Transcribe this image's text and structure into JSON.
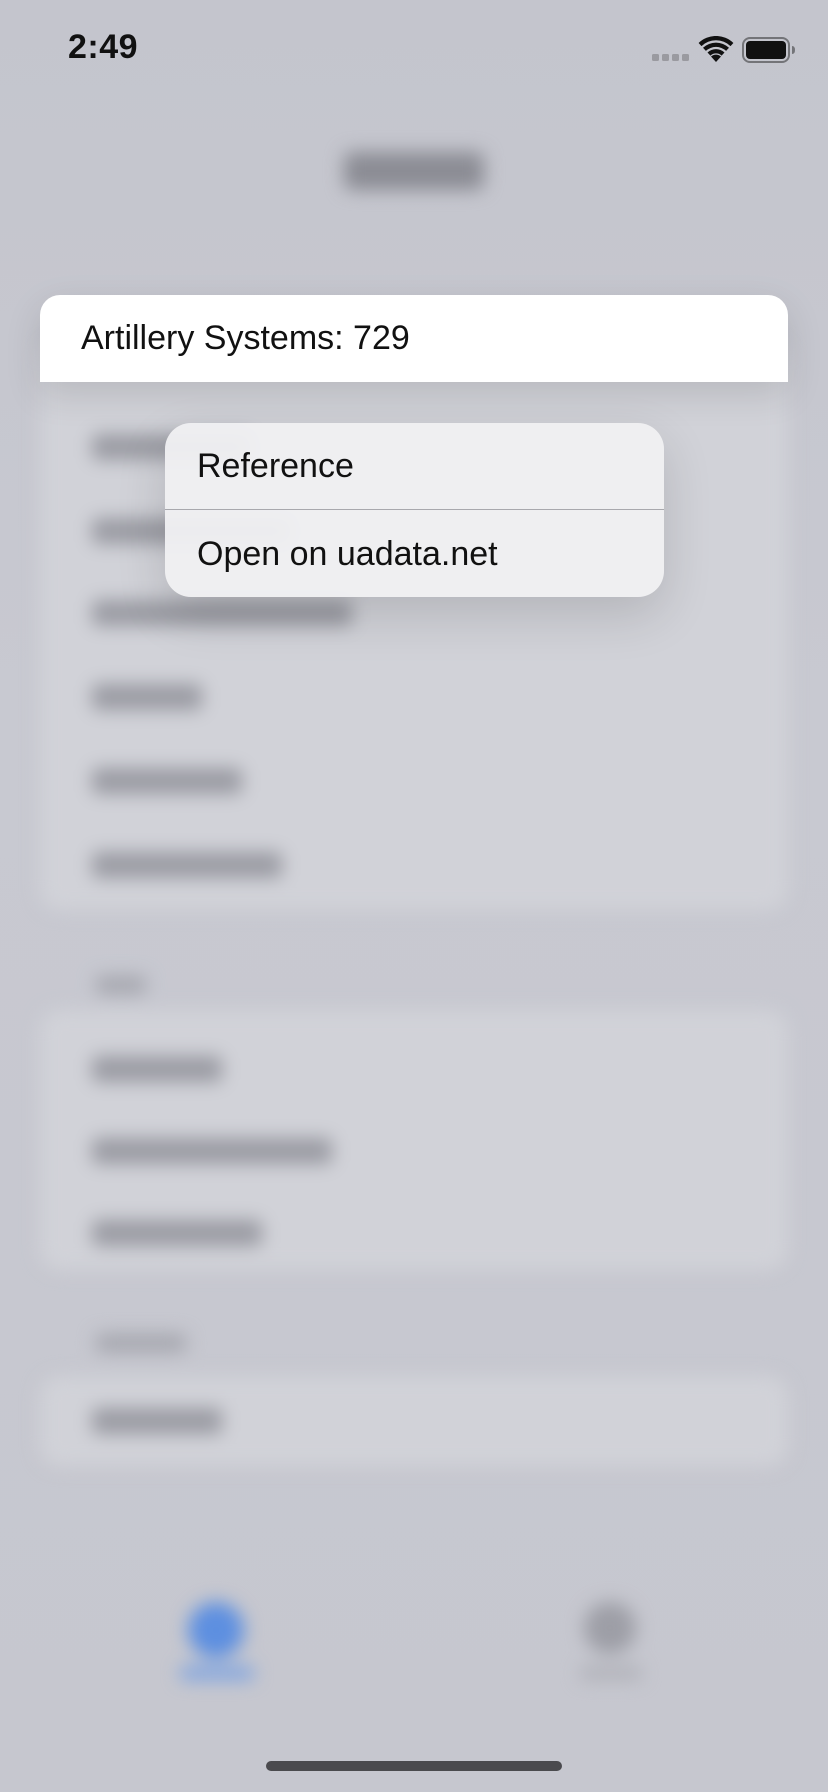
{
  "status_bar": {
    "time": "2:49"
  },
  "preview": {
    "text": "Artillery Systems: 729"
  },
  "context_menu": {
    "items": [
      {
        "label": "Reference",
        "icon": "none"
      },
      {
        "label": "Open on uadata.net",
        "icon": "none"
      }
    ]
  },
  "colors": {
    "tab_accent": "#5d8fe0",
    "menu_background": "#f0f0f2",
    "backdrop": "#c6c7cf"
  }
}
